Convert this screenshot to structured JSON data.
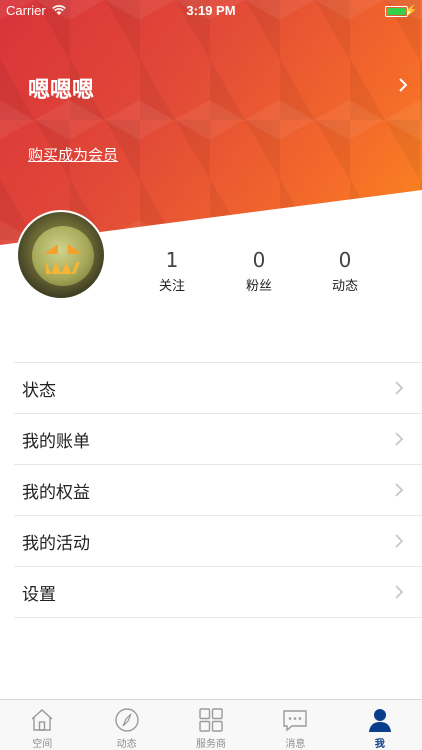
{
  "status_bar": {
    "carrier": "Carrier",
    "time": "3:19 PM"
  },
  "profile": {
    "username": "嗯嗯嗯",
    "buy_member": "购买成为会员"
  },
  "stats": [
    {
      "value": "1",
      "label": "关注"
    },
    {
      "value": "0",
      "label": "粉丝"
    },
    {
      "value": "0",
      "label": "动态"
    }
  ],
  "menu": [
    {
      "label": "状态"
    },
    {
      "label": "我的账单"
    },
    {
      "label": "我的权益"
    },
    {
      "label": "我的活动"
    },
    {
      "label": "设置"
    }
  ],
  "tabs": [
    {
      "label": "空间",
      "icon": "home-icon",
      "active": false
    },
    {
      "label": "动态",
      "icon": "compass-icon",
      "active": false
    },
    {
      "label": "服务商",
      "icon": "grid-icon",
      "active": false
    },
    {
      "label": "消息",
      "icon": "chat-icon",
      "active": false
    },
    {
      "label": "我",
      "icon": "person-icon",
      "active": true
    }
  ],
  "colors": {
    "header_start": "#d9333a",
    "header_end": "#fb8a1d",
    "tab_active": "#0b3e8a",
    "tab_inactive": "#8e8e8e"
  }
}
